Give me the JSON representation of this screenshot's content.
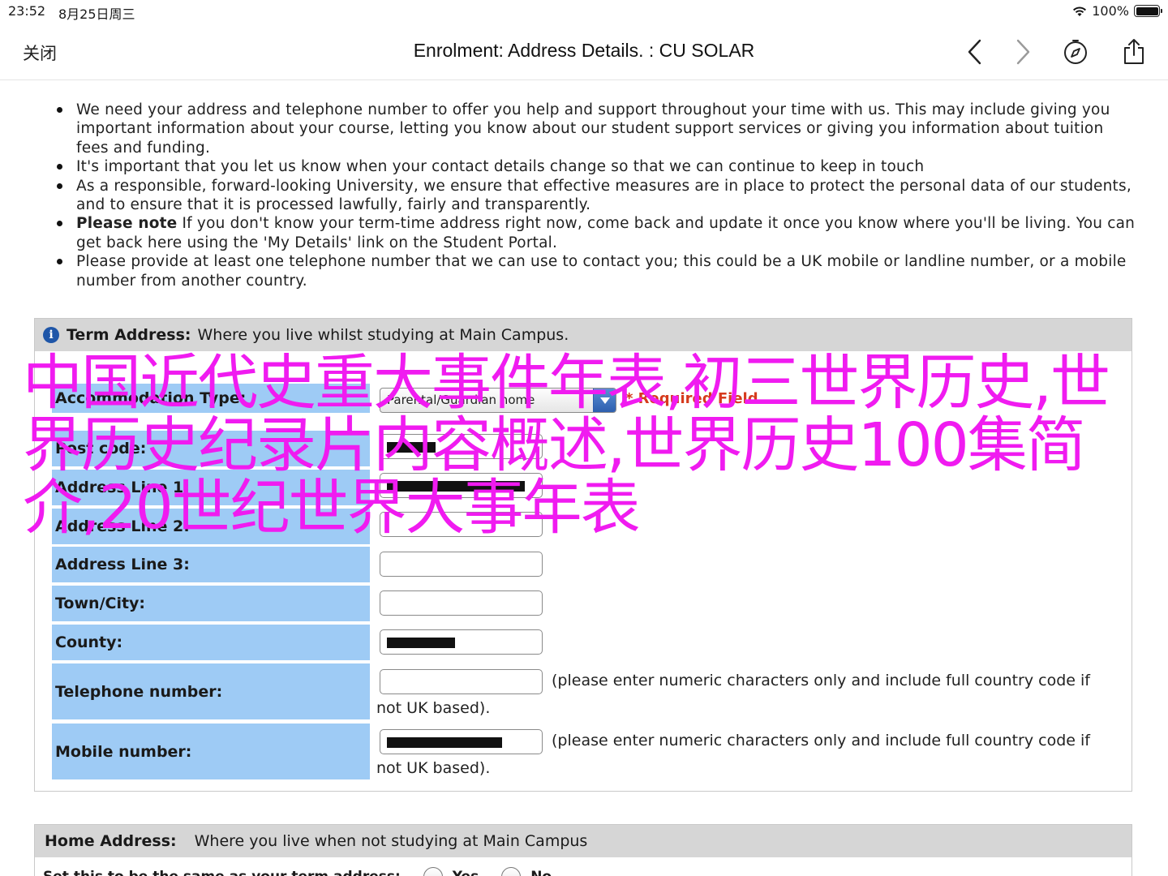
{
  "status_bar": {
    "time": "23:52",
    "date": "8月25日周三",
    "battery": "100%"
  },
  "nav": {
    "close_label": "关闭",
    "title": "Enrolment: Address Details. : CU SOLAR"
  },
  "notes": [
    {
      "bold": "",
      "text": "We need your address and telephone number to offer you help and support throughout your time with us. This may include giving you important information about your course, letting you know about our student support services or giving you information about tuition fees and funding."
    },
    {
      "bold": "",
      "text": "It's important that you let us know when your contact details change so that we can continue to keep in touch"
    },
    {
      "bold": "",
      "text": "As a responsible, forward-looking University, we ensure that effective measures are in place to protect the personal data of our students, and to ensure that it is processed lawfully, fairly and transparently."
    },
    {
      "bold": "Please note",
      "text": " If you don't know your term-time address right now, come back and update it once you know where you'll be living. You can get back here using the 'My Details' link on the Student Portal."
    },
    {
      "bold": "",
      "text": "Please provide at least one telephone number that we can use to contact you; this could be a UK mobile or landline number, or a mobile number from another country."
    }
  ],
  "term_address": {
    "header_bold": "Term Address:",
    "header_text": "Where you live whilst studying at Main Campus.",
    "accommodation_label": "Accommodation Type:",
    "accommodation_value": "Parental/Guardian home",
    "required_text": "* Required Field",
    "postcode_label": "Post code:",
    "address1_label": "Address Line 1:",
    "address2_label": "Address Line 2:",
    "address3_label": "Address Line 3:",
    "town_label": "Town/City:",
    "county_label": "County:",
    "telephone_label": "Telephone number:",
    "telephone_hint": "(please enter numeric characters only and include full country code if not UK based).",
    "mobile_label": "Mobile number:",
    "mobile_hint": "(please enter numeric characters only and include full country code if not UK based)."
  },
  "home_address": {
    "header_bold": "Home Address:",
    "header_text": "Where you live when not studying at Main Campus",
    "same_label": "Set this to be the same as your term address:",
    "yes_label": "Yes",
    "no_label": "No"
  },
  "overlay_text": "中国近代史重大事件年表,初三世界历史,世界历史纪录片内容概述,世界历史100集简介,20世纪世界大事年表",
  "colors": {
    "label_bg": "#9ecbf5",
    "header_bg": "#d6d6d6",
    "overlay": "#f01bf0",
    "required": "#d63b1d"
  }
}
